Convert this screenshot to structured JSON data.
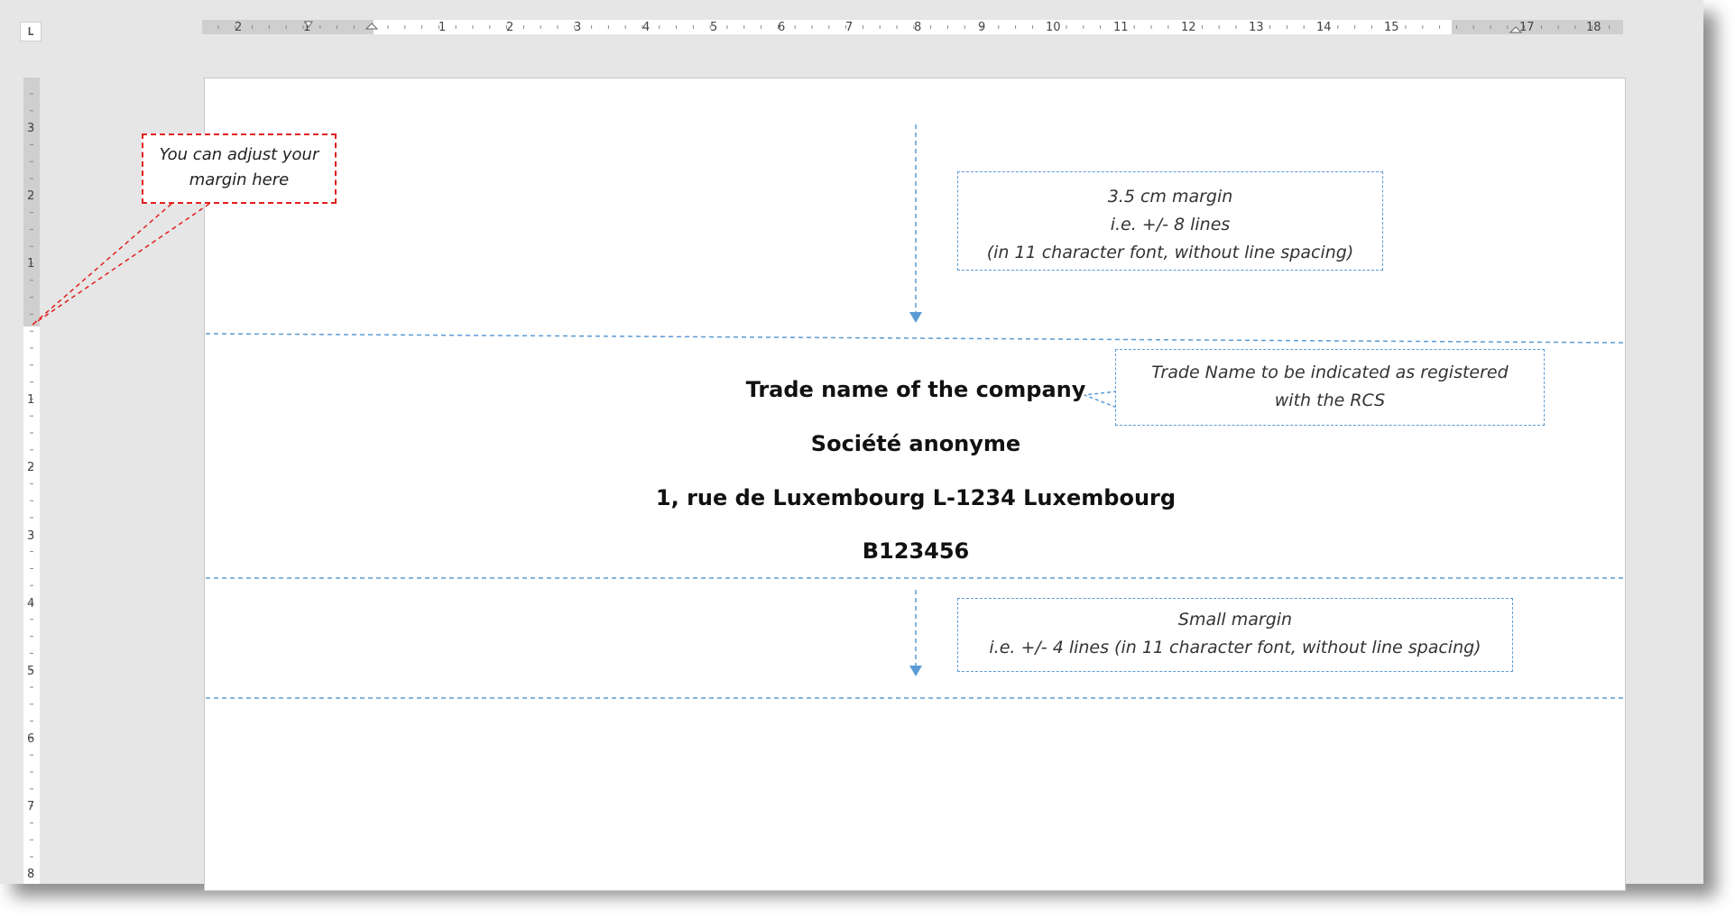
{
  "ruler": {
    "tab_selector": "L",
    "h_numbers": [
      "2",
      "1",
      "1",
      "2",
      "3",
      "4",
      "5",
      "6",
      "7",
      "8",
      "9",
      "10",
      "11",
      "12",
      "13",
      "14",
      "15",
      "17",
      "18"
    ],
    "v_numbers": [
      "3",
      "2",
      "1",
      "1",
      "2",
      "3",
      "4",
      "5",
      "6",
      "7",
      "8"
    ]
  },
  "annotations": {
    "margin_hint": [
      "You can adjust your",
      "margin here"
    ],
    "top_margin": [
      "3.5 cm margin",
      "i.e. +/- 8 lines",
      "(in 11 character font, without line spacing)"
    ],
    "trade_name": [
      "Trade Name to be indicated as registered",
      "with the RCS"
    ],
    "small_margin": [
      "Small margin",
      "i.e. +/- 4 lines (in 11 character font, without line spacing)"
    ]
  },
  "document": {
    "company_name": "Trade name of the company",
    "company_form": "Société anonyme",
    "address": "1, rue de Luxembourg L-1234 Luxembourg",
    "registration": "B123456"
  },
  "colors": {
    "guide": "#5b9bd5",
    "hint": "#e21f1f",
    "ruler_margin": "#cfcfcf"
  }
}
